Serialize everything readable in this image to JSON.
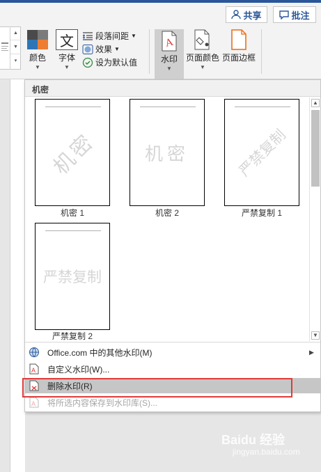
{
  "ribbon": {
    "share_label": "共享",
    "comment_label": "批注",
    "colors_label": "颜色",
    "fonts_label": "字体",
    "paragraph_spacing_label": "段落间距",
    "effects_label": "效果",
    "set_default_label": "设为默认值",
    "watermark_label": "水印",
    "page_color_label": "页面颜色",
    "page_borders_label": "页面边框",
    "fonts_glyph": "文"
  },
  "dropdown": {
    "section_header": "机密",
    "thumbnails": [
      {
        "watermark": "机密",
        "caption": "机密 1"
      },
      {
        "watermark": "机密",
        "caption": "机密 2"
      },
      {
        "watermark": "严禁复制",
        "caption": "严禁复制 1"
      },
      {
        "watermark": "严禁复制",
        "caption": "严禁复制 2"
      }
    ],
    "menu": [
      {
        "label": "Office.com 中的其他水印(M)",
        "icon": "globe-icon",
        "state": "normal"
      },
      {
        "label": "自定义水印(W)...",
        "icon": "custom-watermark-icon",
        "state": "normal"
      },
      {
        "label": "删除水印(R)",
        "icon": "remove-watermark-icon",
        "state": "hover"
      },
      {
        "label": "将所选内容保存到水印库(S)...",
        "icon": "save-to-gallery-icon",
        "state": "disabled"
      }
    ]
  },
  "watermark_overlay": {
    "brand": "Baidu 经验",
    "url": "jingyan.baidu.com"
  },
  "colors": {
    "accent": "#2b579a",
    "highlight": "#e03a3a",
    "hover": "#c6c6c6"
  }
}
